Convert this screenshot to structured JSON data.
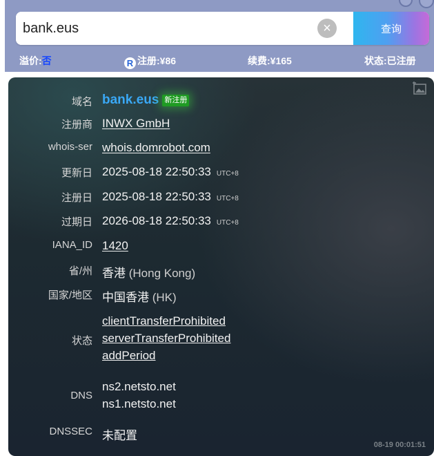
{
  "search": {
    "query": "bank.eus",
    "clear_symbol": "×",
    "submit_label": "查询"
  },
  "info_bar": {
    "premium_label": "溢价:",
    "premium_value": "否",
    "register_icon_glyph": "R",
    "register_label": "注册:",
    "register_price": "¥86",
    "renew_label": "续费:",
    "renew_price": "¥165",
    "status_label": "状态:",
    "status_value": "已注册"
  },
  "whois": {
    "domain": {
      "label": "域名",
      "value": "bank.eus",
      "badge": "新注册"
    },
    "registrar": {
      "label": "注册商",
      "value": "INWX GmbH"
    },
    "whois_server": {
      "label": "whois-ser",
      "value": "whois.domrobot.com"
    },
    "updated": {
      "label": "更新日",
      "value": "2025-08-18 22:50:33",
      "tz": "UTC+8"
    },
    "created": {
      "label": "注册日",
      "value": "2025-08-18 22:50:33",
      "tz": "UTC+8"
    },
    "expires": {
      "label": "过期日",
      "value": "2026-08-18 22:50:33",
      "tz": "UTC+8"
    },
    "iana_id": {
      "label": "IANA_ID",
      "value": "1420"
    },
    "province": {
      "label": "省/州",
      "value": "香港",
      "sub": "(Hong Kong)"
    },
    "country": {
      "label": "国家/地区",
      "value": "中国香港",
      "sub": "(HK)"
    },
    "status": {
      "label": "状态",
      "values": [
        "clientTransferProhibited",
        "serverTransferProhibited",
        "addPeriod"
      ]
    },
    "dns": {
      "label": "DNS",
      "values": [
        "ns2.netsto.net",
        "ns1.netsto.net"
      ]
    },
    "dnssec": {
      "label": "DNSSEC",
      "value": "未配置"
    },
    "query_time": "08-19 00:01:51"
  },
  "colors": {
    "band": "#8e9ac4",
    "accent_blue": "#3aa8f5",
    "badge_green": "#1f9b23",
    "panel_dark": "#1d2a31"
  }
}
